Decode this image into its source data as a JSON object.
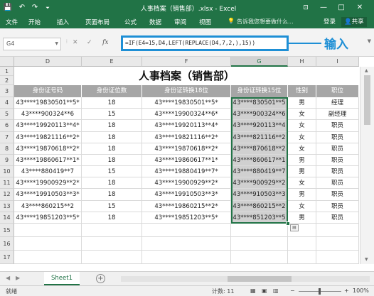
{
  "window": {
    "title": "人事档案（销售部）.xlsx - Excel",
    "minimize": "—",
    "restore": "□",
    "close": "✕",
    "ribbon_collapse": "⊡"
  },
  "quick_access": {
    "save_glyph": "💾",
    "undo_glyph": "↶",
    "redo_glyph": "↷",
    "customize_glyph": "⏷"
  },
  "ribbon": {
    "tabs": [
      "文件",
      "开始",
      "插入",
      "页面布局",
      "公式",
      "数据",
      "审阅",
      "视图"
    ],
    "tell_me": "告诉我您想要做什么...",
    "login": "登录",
    "share": "共享"
  },
  "formula_bar": {
    "name_box": "G4",
    "cancel_icon": "✕",
    "enter_icon": "✓",
    "fx_label": "fx",
    "formula": "=IF(E4=15,D4,LEFT(REPLACE(D4,7,2,),15))",
    "callout": "输入"
  },
  "columns": [
    "D",
    "E",
    "F",
    "G",
    "H",
    "I"
  ],
  "row_numbers": [
    "1",
    "2",
    "3",
    "4",
    "5",
    "6",
    "7",
    "8",
    "9",
    "10",
    "11",
    "12",
    "13",
    "14",
    "15",
    "16",
    "17"
  ],
  "sheet_title": "人事档案（销售部）",
  "headers": [
    "身份证号码",
    "身份证位数",
    "身份证转换18位",
    "身份证转换15位",
    "性别",
    "职位"
  ],
  "rows": [
    {
      "id": "43****19830501**5*",
      "digits": "18",
      "id18": "43****19830501**5*",
      "id15": "43****830501**5",
      "gender": "男",
      "position": "经理"
    },
    {
      "id": "43****900324**6",
      "digits": "15",
      "id18": "43****19900324**6*",
      "id15": "43****900324**6",
      "gender": "女",
      "position": "副经理"
    },
    {
      "id": "43****19920113**4*",
      "digits": "18",
      "id18": "43****19920113**4*",
      "id15": "43****920113**4",
      "gender": "女",
      "position": "职员"
    },
    {
      "id": "43****19821116**2*",
      "digits": "18",
      "id18": "43****19821116**2*",
      "id15": "43****821116**2",
      "gender": "女",
      "position": "职员"
    },
    {
      "id": "43****19870618**2*",
      "digits": "18",
      "id18": "43****19870618**2*",
      "id15": "43****870618**2",
      "gender": "女",
      "position": "职员"
    },
    {
      "id": "43****19860617**1*",
      "digits": "18",
      "id18": "43****19860617**1*",
      "id15": "43****860617**1",
      "gender": "男",
      "position": "职员"
    },
    {
      "id": "43****880419**7",
      "digits": "15",
      "id18": "43****19880419**7*",
      "id15": "43****880419**7",
      "gender": "男",
      "position": "职员"
    },
    {
      "id": "43****19900929**2*",
      "digits": "18",
      "id18": "43****19900929**2*",
      "id15": "43****900929**2",
      "gender": "女",
      "position": "职员"
    },
    {
      "id": "43****19910503**3*",
      "digits": "18",
      "id18": "43****19910503**3*",
      "id15": "43****910503**3",
      "gender": "男",
      "position": "职员"
    },
    {
      "id": "43****860215**2",
      "digits": "15",
      "id18": "43****19860215**2*",
      "id15": "43****860215**2",
      "gender": "女",
      "position": "职员"
    },
    {
      "id": "43****19851203**5*",
      "digits": "18",
      "id18": "43****19851203**5*",
      "id15": "43****851203**5",
      "gender": "男",
      "position": "职员"
    }
  ],
  "sheet_tabs": [
    "Sheet1"
  ],
  "add_sheet": "+",
  "status": {
    "mode": "就绪",
    "count": "计数: 11",
    "zoom_minus": "−",
    "zoom_plus": "+",
    "zoom": "100%"
  }
}
